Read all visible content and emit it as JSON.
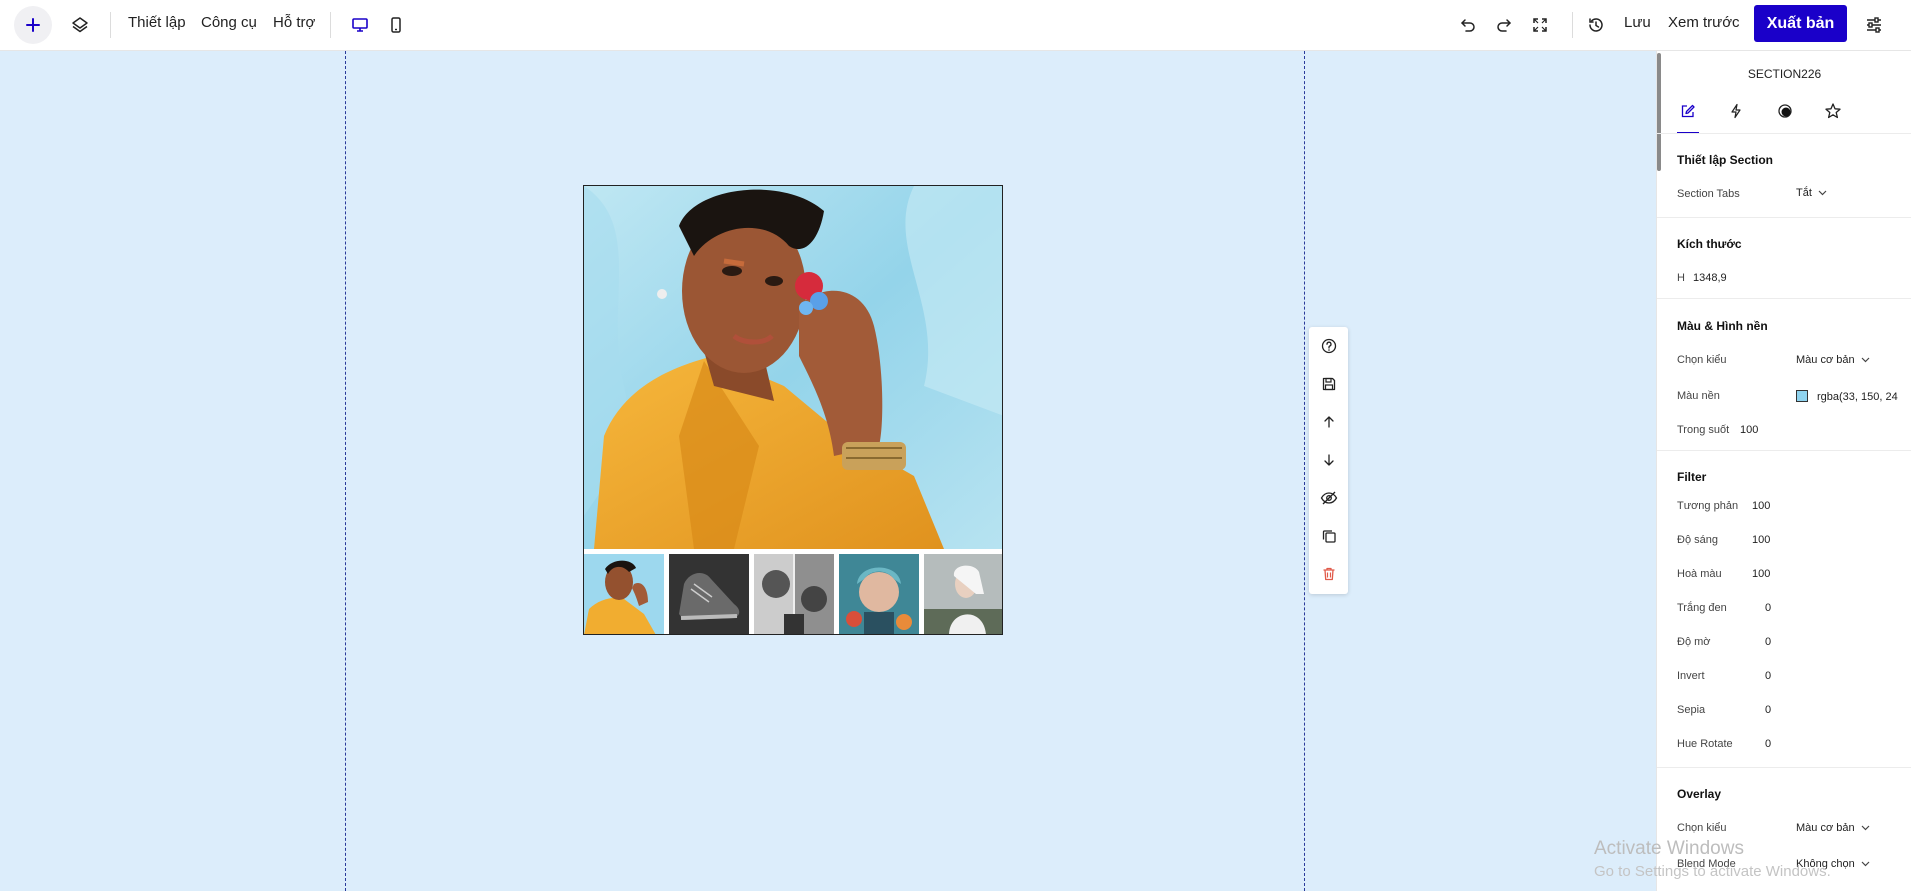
{
  "toolbar": {
    "menu": [
      "Thiết lập",
      "Công cụ",
      "Hỗ trợ"
    ],
    "save_label": "Lưu",
    "preview_label": "Xem trước",
    "publish_label": "Xuất bản"
  },
  "accent_color": "#1a00c9",
  "canvas": {
    "background": "#dcedfb",
    "gallery": {
      "thumbnail_count": 5,
      "selected_thumbnail_index": 0
    },
    "section_tools": [
      "help-icon",
      "save-icon",
      "arrow-up-icon",
      "arrow-down-icon",
      "eye-off-icon",
      "copy-icon",
      "trash-icon"
    ]
  },
  "panel": {
    "title": "SECTION226",
    "tabs": [
      "edit-icon",
      "bolt-icon",
      "contrast-icon",
      "star-icon"
    ],
    "section_settings": {
      "heading": "Thiết lập Section",
      "tabs_label": "Section Tabs",
      "tabs_value": "Tắt"
    },
    "size": {
      "heading": "Kích thước",
      "h_label": "H",
      "h_value": "1348,9"
    },
    "background": {
      "heading": "Màu & Hình nền",
      "style_label": "Chọn kiểu",
      "style_value": "Màu cơ bản",
      "color_label": "Màu nền",
      "color_value": "rgba(33, 150, 24",
      "opacity_label": "Trong suốt",
      "opacity_value": "100"
    },
    "filter": {
      "heading": "Filter",
      "rows": [
        {
          "label": "Tương phản",
          "value": "100"
        },
        {
          "label": "Độ sáng",
          "value": "100"
        },
        {
          "label": "Hoà màu",
          "value": "100"
        },
        {
          "label": "Trắng đen",
          "value": "0"
        },
        {
          "label": "Độ mờ",
          "value": "0"
        },
        {
          "label": "Invert",
          "value": "0"
        },
        {
          "label": "Sepia",
          "value": "0"
        },
        {
          "label": "Hue Rotate",
          "value": "0"
        }
      ]
    },
    "overlay": {
      "heading": "Overlay",
      "style_label": "Chọn kiểu",
      "style_value": "Màu cơ bản",
      "blend_label": "Blend Mode",
      "blend_value": "Không chọn"
    }
  },
  "watermark": {
    "line1": "Activate Windows",
    "line2": "Go to Settings to activate Windows."
  }
}
